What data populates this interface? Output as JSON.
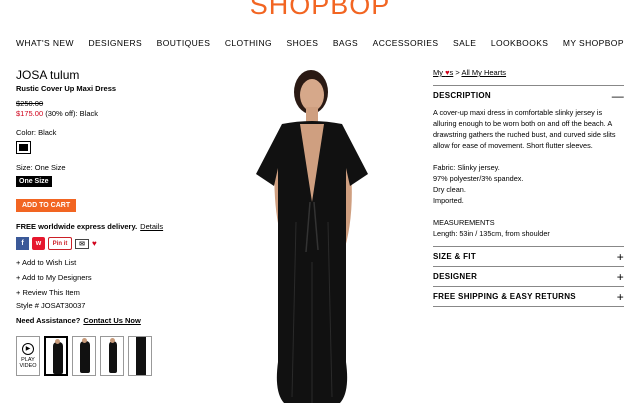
{
  "logo": "SHOPBOP",
  "nav": [
    "WHAT'S NEW",
    "DESIGNERS",
    "BOUTIQUES",
    "CLOTHING",
    "SHOES",
    "BAGS",
    "ACCESSORIES",
    "SALE",
    "LOOKBOOKS",
    "MY SHOPBOP"
  ],
  "product": {
    "brand": "JOSA tulum",
    "name": "Rustic Cover Up Maxi Dress",
    "original_price": "$250.00",
    "sale_price": "$175.00",
    "sale_note": " (30% off): Black",
    "color_label": "Color: Black",
    "size_label": "Size: One Size",
    "size_button": "One Size",
    "add_to_cart": "ADD TO CART",
    "delivery": "FREE worldwide express delivery.",
    "details_link": "Details",
    "wish_list": "+ Add to Wish List",
    "my_designers": "+ Add to My Designers",
    "review": "+ Review This Item",
    "style_no": "Style # JOSAT30037",
    "assist_label": "Need Assistance?",
    "contact_link": "Contact Us Now",
    "video_label": "PLAY VIDEO",
    "social_pin": "Pin it"
  },
  "breadcrumb": {
    "my": "My",
    "s": "s",
    "sep": ">",
    "all_hearts": "All My Hearts"
  },
  "sections": {
    "description_title": "DESCRIPTION",
    "description_text": "A cover-up maxi dress in comfortable slinky jersey is alluring enough to be worn both on and off the beach. A drawstring gathers the ruched bust, and curved side slits allow for ease of movement. Short flutter sleeves.",
    "fabric": "Fabric: Slinky jersey.",
    "composition": "97% polyester/3% spandex.",
    "care1": "Dry clean.",
    "care2": "Imported.",
    "measurements_title": "MEASUREMENTS",
    "measurements": "Length: 53in / 135cm, from shoulder",
    "size_fit": "SIZE & FIT",
    "designer": "DESIGNER",
    "shipping": "FREE SHIPPING & EASY RETURNS",
    "minus": "—",
    "plus": "+"
  },
  "colors": {
    "brand_orange": "#f26522",
    "sale_red": "#d0021b"
  }
}
